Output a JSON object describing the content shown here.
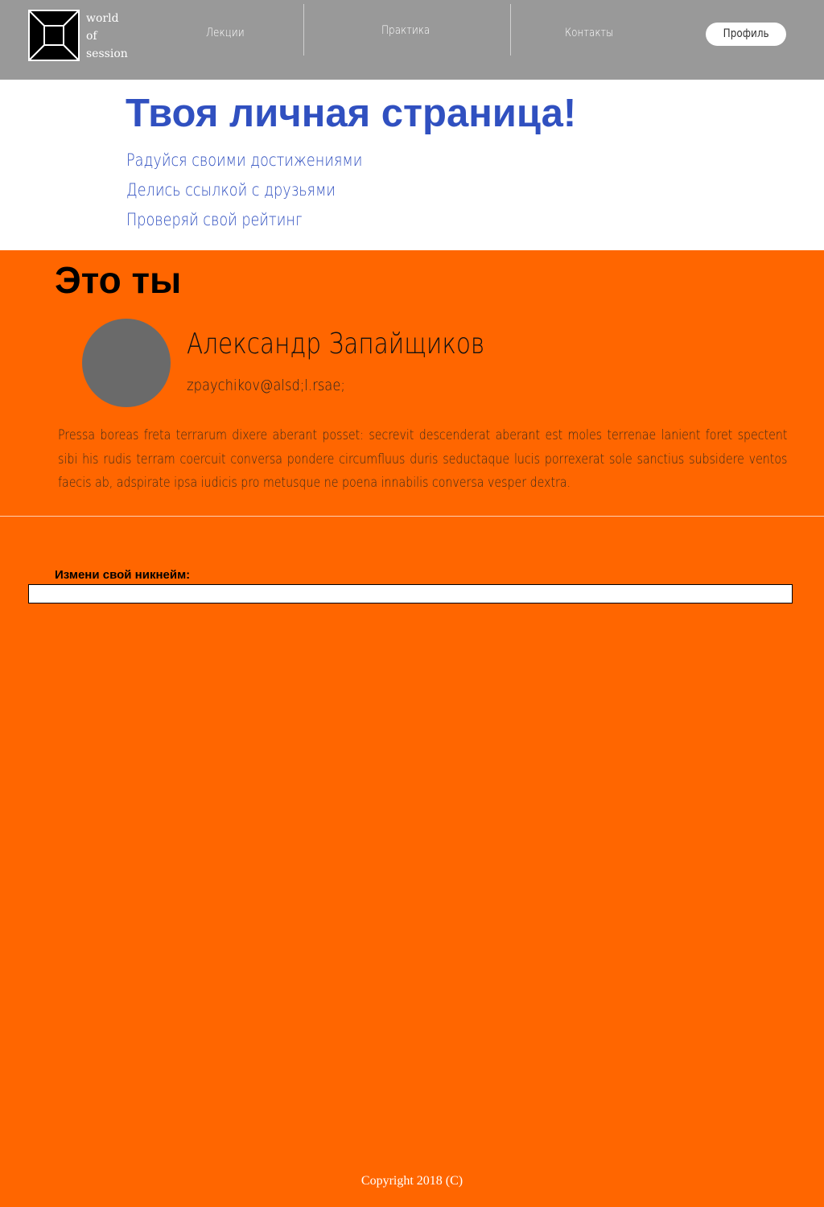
{
  "header": {
    "logo": {
      "icon": "square-frame-logo-icon",
      "lines": [
        "world",
        "of",
        "session"
      ]
    },
    "nav": [
      {
        "label": "Лекции"
      },
      {
        "label": "Практика"
      },
      {
        "label": "Контакты"
      }
    ],
    "profile_button": "Профиль"
  },
  "hero": {
    "title": "Твоя личная страница!",
    "lines": [
      "Радуйся своими достижениями",
      "Делись ссылкой с друзьями",
      "Проверяй свой рейтинг"
    ]
  },
  "profile": {
    "section_title": "Это ты",
    "avatar": "avatar-placeholder",
    "name": "Александр Запайщиков",
    "email": "zpaychikov@alsd;l.rsae;",
    "bio": "Pressa boreas freta terrarum dixere aberant posset: secrevit descenderat aberant est moles terrenae lanient foret spectent sibi his rudis terram coercuit conversa pondere circumfluus duris seductaque lucis porrexerat sole sanctius subsidere ventos faecis ab, adspirate ipsa iudicis pro metusque ne poena innabilis conversa vesper dextra."
  },
  "nickname": {
    "label": "Измени свой никнейм:",
    "value": "",
    "placeholder": ""
  },
  "footer": {
    "copyright": "Copyright 2018 (C)"
  },
  "colors": {
    "header_bg": "#999999",
    "accent_blue": "#3050c0",
    "page_bg": "#ff6600",
    "avatar": "#6a6a6a"
  }
}
